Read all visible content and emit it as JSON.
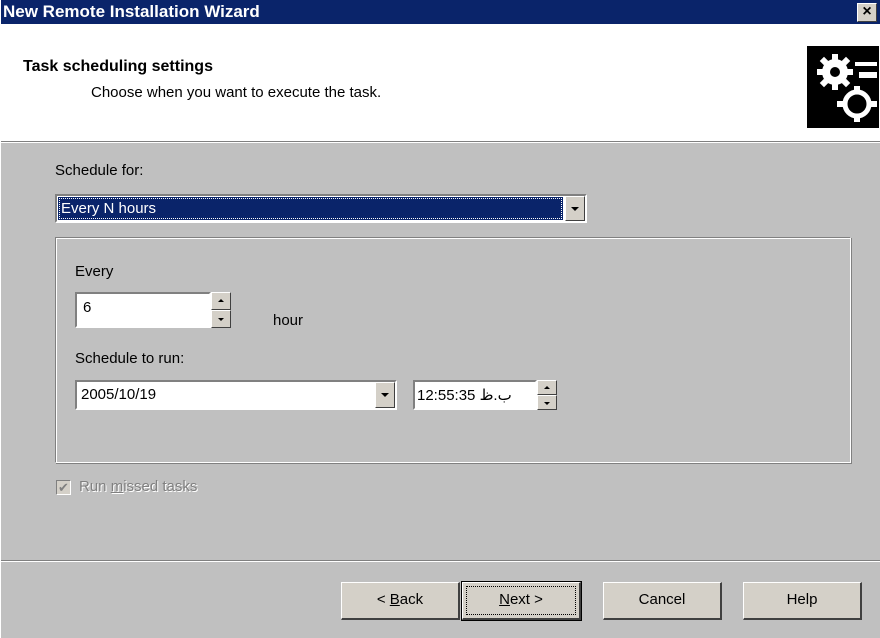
{
  "window": {
    "title": "New Remote Installation Wizard",
    "close_label": "×"
  },
  "header": {
    "title": "Task scheduling settings",
    "subtitle": "Choose when you want to execute the task.",
    "icon": "gears-icon"
  },
  "schedule_for": {
    "label": "Schedule for:",
    "selected": "Every N hours"
  },
  "every": {
    "label": "Every",
    "value": "6",
    "unit": "hour"
  },
  "schedule_to_run": {
    "label": "Schedule to run:",
    "date": "2005/10/19",
    "time": "12:55:35 ب.ظ"
  },
  "run_missed": {
    "label_pre": "Run ",
    "label_mnemonic": "m",
    "label_post": "issed tasks",
    "checked": true,
    "enabled": false
  },
  "buttons": {
    "back_pre": "< ",
    "back_mnemonic": "B",
    "back_post": "ack",
    "next_mnemonic": "N",
    "next_post": "ext >",
    "cancel": "Cancel",
    "help": "Help"
  },
  "colors": {
    "titlebar": "#0a246a",
    "face": "#c0c0c0",
    "selection": "#0a246a"
  }
}
